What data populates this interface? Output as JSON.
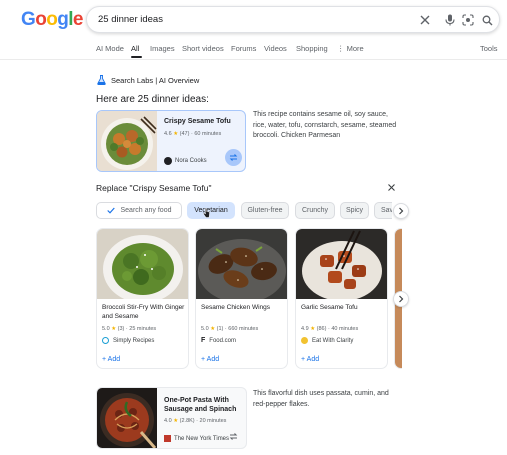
{
  "logo": [
    "G",
    "o",
    "o",
    "g",
    "l",
    "e"
  ],
  "logo_colors": [
    "#4285f4",
    "#ea4335",
    "#fbbc05",
    "#4285f4",
    "#34a853",
    "#ea4335"
  ],
  "search": {
    "query": "25 dinner ideas"
  },
  "tabs": [
    "AI Mode",
    "All",
    "Images",
    "Short videos",
    "Forums",
    "Videos",
    "Shopping",
    "More",
    "Tools"
  ],
  "tab_more_prefix": "⋮",
  "overview": {
    "labs_label": "Search Labs | AI Overview",
    "heading": "Here are 25 dinner ideas:"
  },
  "featured": {
    "title": "Crispy Sesame Tofu",
    "rating": "4.6",
    "star": "★",
    "meta": "(47) · 60 minutes",
    "source": "Nora Cooks",
    "description": "This recipe contains sesame oil, soy sauce, rice, water, tofu, cornstarch, sesame, steamed broccoli. Chicken Parmesan"
  },
  "replace": {
    "label": "Replace \"Crispy Sesame Tofu\"",
    "close": "✕",
    "search_chip": "Search any food",
    "chips": [
      "Vegetarian",
      "Gluten-free",
      "Crunchy",
      "Spicy",
      "Savory"
    ]
  },
  "recipes": [
    {
      "title": "Broccoli Stir-Fry With Ginger and Sesame",
      "rating": "5.0",
      "meta": "(3) · 25 minutes",
      "source": "Simply Recipes",
      "add": "Add"
    },
    {
      "title": "Sesame Chicken Wings",
      "rating": "5.0",
      "meta": "(1) · 660 minutes",
      "source": "Food.com",
      "add": "Add"
    },
    {
      "title": "Garlic Sesame Tofu",
      "rating": "4.9",
      "meta": "(86) · 40 minutes",
      "source": "Eat With Clarity",
      "add": "Add"
    }
  ],
  "second": {
    "title": "One-Pot Pasta With Sausage and Spinach",
    "rating": "4.0",
    "meta": "(2.8K) · 20 minutes",
    "source": "The New York Times",
    "description": "This flavorful dish uses passata, cumin, and red-pepper flakes."
  },
  "colors": {
    "accent": "#1a73e8",
    "chip_selected": "#d3e3fd",
    "card_selected_border": "#a8c7fa",
    "star": "#f4b400"
  }
}
